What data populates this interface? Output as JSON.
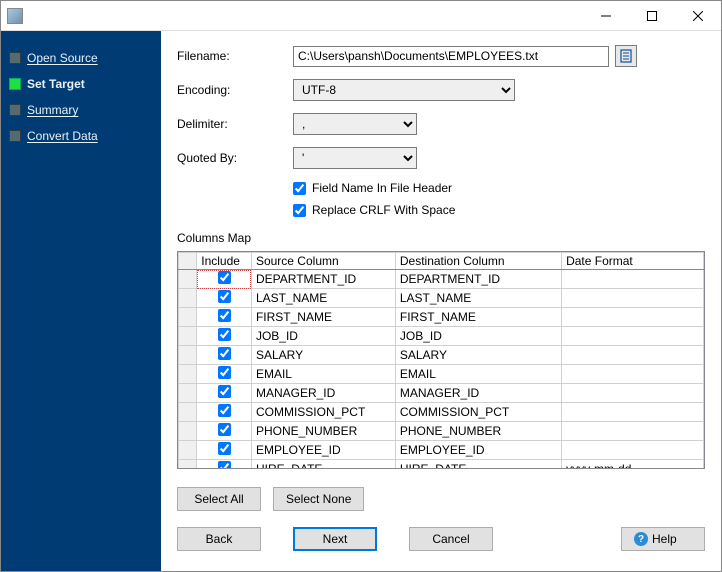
{
  "nav": {
    "items": [
      {
        "label": "Open Source",
        "active": false
      },
      {
        "label": "Set Target",
        "active": true
      },
      {
        "label": "Summary",
        "active": false
      },
      {
        "label": "Convert Data",
        "active": false
      }
    ]
  },
  "form": {
    "filename_label": "Filename:",
    "filename_value": "C:\\Users\\pansh\\Documents\\EMPLOYEES.txt",
    "encoding_label": "Encoding:",
    "encoding_value": "UTF-8",
    "delimiter_label": "Delimiter:",
    "delimiter_value": ",",
    "quoted_label": "Quoted By:",
    "quoted_value": "'",
    "check_header_label": "Field Name In File Header",
    "check_header": true,
    "check_crlf_label": "Replace CRLF With Space",
    "check_crlf": true
  },
  "columns": {
    "section_label": "Columns Map",
    "headers": {
      "include": "Include",
      "source": "Source Column",
      "dest": "Destination Column",
      "fmt": "Date Format"
    },
    "rows": [
      {
        "include": true,
        "source": "DEPARTMENT_ID",
        "dest": "DEPARTMENT_ID",
        "fmt": ""
      },
      {
        "include": true,
        "source": "LAST_NAME",
        "dest": "LAST_NAME",
        "fmt": ""
      },
      {
        "include": true,
        "source": "FIRST_NAME",
        "dest": "FIRST_NAME",
        "fmt": ""
      },
      {
        "include": true,
        "source": "JOB_ID",
        "dest": "JOB_ID",
        "fmt": ""
      },
      {
        "include": true,
        "source": "SALARY",
        "dest": "SALARY",
        "fmt": ""
      },
      {
        "include": true,
        "source": "EMAIL",
        "dest": "EMAIL",
        "fmt": ""
      },
      {
        "include": true,
        "source": "MANAGER_ID",
        "dest": "MANAGER_ID",
        "fmt": ""
      },
      {
        "include": true,
        "source": "COMMISSION_PCT",
        "dest": "COMMISSION_PCT",
        "fmt": ""
      },
      {
        "include": true,
        "source": "PHONE_NUMBER",
        "dest": "PHONE_NUMBER",
        "fmt": ""
      },
      {
        "include": true,
        "source": "EMPLOYEE_ID",
        "dest": "EMPLOYEE_ID",
        "fmt": ""
      },
      {
        "include": true,
        "source": "HIRE_DATE",
        "dest": "HIRE_DATE",
        "fmt": "yyyy-mm-dd"
      }
    ]
  },
  "buttons": {
    "select_all": "Select All",
    "select_none": "Select None",
    "back": "Back",
    "next": "Next",
    "cancel": "Cancel",
    "help": "Help"
  }
}
